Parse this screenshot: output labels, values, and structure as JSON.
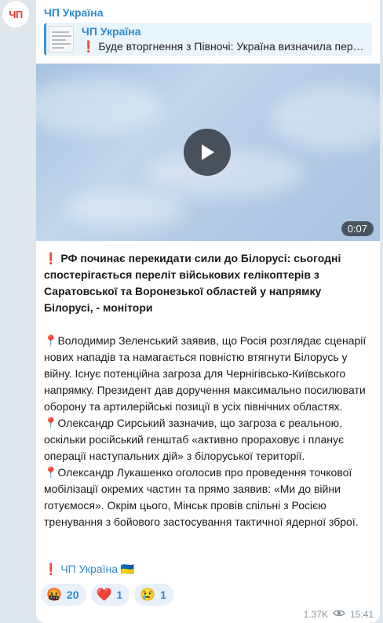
{
  "channel": {
    "avatar_text": "ЧП",
    "name": "ЧП Україна"
  },
  "reply": {
    "title": "ЧП Україна",
    "text": "❗ Буде вторгнення з Півночі: Україна визначила пер…"
  },
  "media": {
    "duration": "0:07"
  },
  "post": {
    "headline_mark": "❗",
    "headline": "РФ починає перекидати сили до Білорусі: сьогодні спостерігається переліт військових гелікоптерів з Саратовської та Воронезької областей у напрямку Білорусі, - монітори",
    "pin": "📍",
    "para1": "Володимир Зеленський заявив, що Росія розглядає сценарії нових нападів та намагається повністю втягнути Білорусь у війну. Існує потенційна загроза для Чернігівсько-Київського напрямку. Президент дав доручення максимально посилювати оборону та артилерійські позиції в усіх північних областях.",
    "para2": "Олександр Сирський зазначив, що загроза є реальною, оскільки російський генштаб «активно прораховує і планує операції наступальних дій» з білоруської території.",
    "para3": "Олександр Лукашенко оголосив про проведення точкової мобілізації окремих частин та прямо заявив: «Ми до війни готуємося». Окрім цього, Мінськ провів спільні з Росією тренування з бойового застосування тактичної ядерної зброї."
  },
  "signature": {
    "mark": "❗",
    "link": "ЧП Україна",
    "flag": "🇺🇦"
  },
  "reactions": [
    {
      "emoji": "🤬",
      "count": "20"
    },
    {
      "emoji": "❤️",
      "count": "1"
    },
    {
      "emoji": "😢",
      "count": "1"
    }
  ],
  "meta": {
    "views": "1.37K",
    "time": "15:41"
  },
  "colors": {
    "accent": "#2f8bd0",
    "alert": "#e02424",
    "background": "#dfe6ec"
  }
}
